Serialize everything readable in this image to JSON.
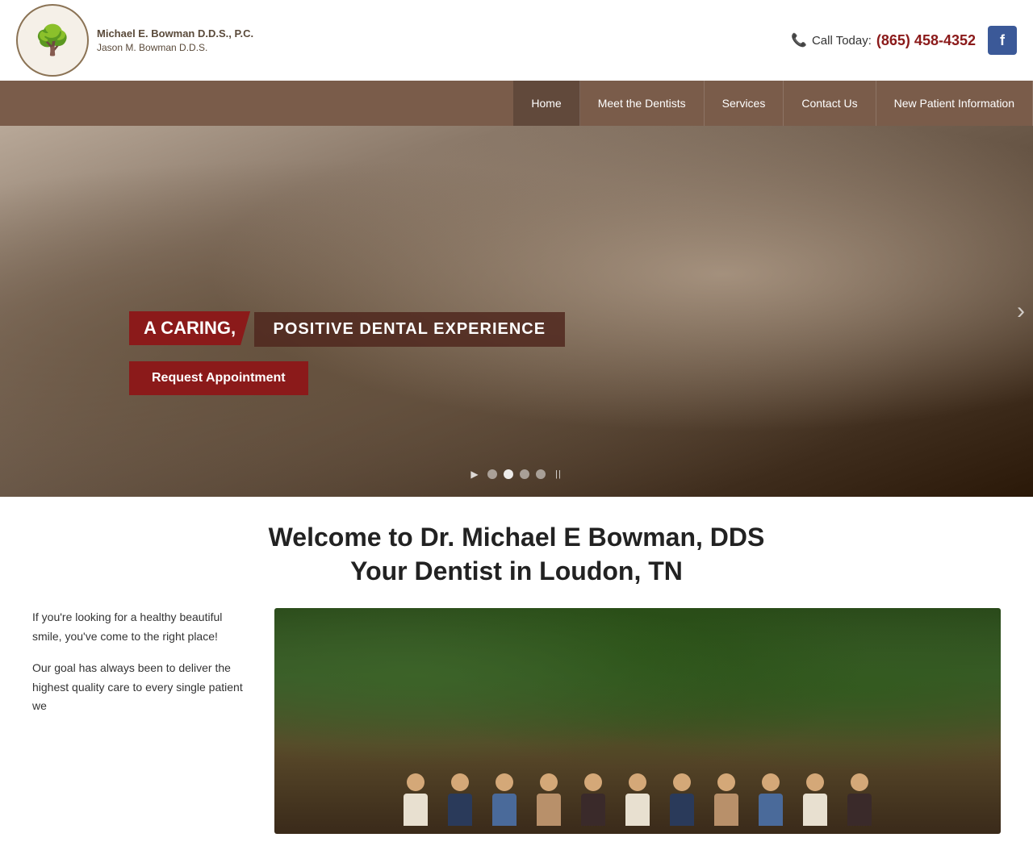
{
  "header": {
    "logo": {
      "name1": "Michael E. Bowman D.D.S., P.C.",
      "name2": "Jason M. Bowman D.D.S.",
      "tree_icon": "🌳"
    },
    "call_label": "Call Today:",
    "phone": "(865) 458-4352",
    "facebook_label": "f"
  },
  "nav": {
    "items": [
      {
        "label": "Home",
        "active": true
      },
      {
        "label": "Meet the Dentists",
        "active": false
      },
      {
        "label": "Services",
        "active": false
      },
      {
        "label": "Contact Us",
        "active": false
      },
      {
        "label": "New Patient Information",
        "active": false
      }
    ]
  },
  "hero": {
    "tag1": "A CARING,",
    "tag2": "POSITIVE DENTAL EXPERIENCE",
    "button_label": "Request Appointment",
    "arrow_right": "›",
    "slider": {
      "play": "▶",
      "pause": "||",
      "dots": [
        {
          "active": false
        },
        {
          "active": true
        },
        {
          "active": false
        },
        {
          "active": false
        }
      ]
    }
  },
  "welcome": {
    "title_line1": "Welcome to Dr. Michael E Bowman, DDS",
    "title_line2": "Your Dentist in Loudon, TN",
    "paragraph1": "If you're looking for a healthy beautiful smile, you've come to the right place!",
    "paragraph2": "Our goal has always been to deliver the highest quality care to every single patient we"
  }
}
